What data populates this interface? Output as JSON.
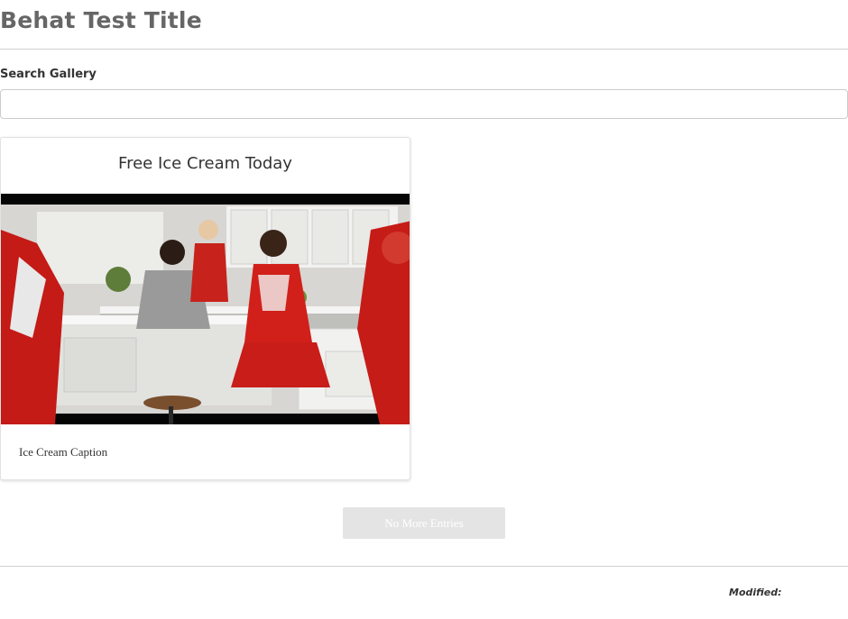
{
  "header": {
    "title": "Behat Test Title"
  },
  "search": {
    "label": "Search Gallery",
    "value": "",
    "placeholder": ""
  },
  "gallery": {
    "items": [
      {
        "title": "Free Ice Cream Today",
        "caption": "Ice Cream Caption",
        "image_alt": "Ice cream commercial scene with cheerleaders in a kitchen"
      }
    ]
  },
  "pagination": {
    "button_label": "No More Entries"
  },
  "footer": {
    "modified_label": "Modified:"
  }
}
